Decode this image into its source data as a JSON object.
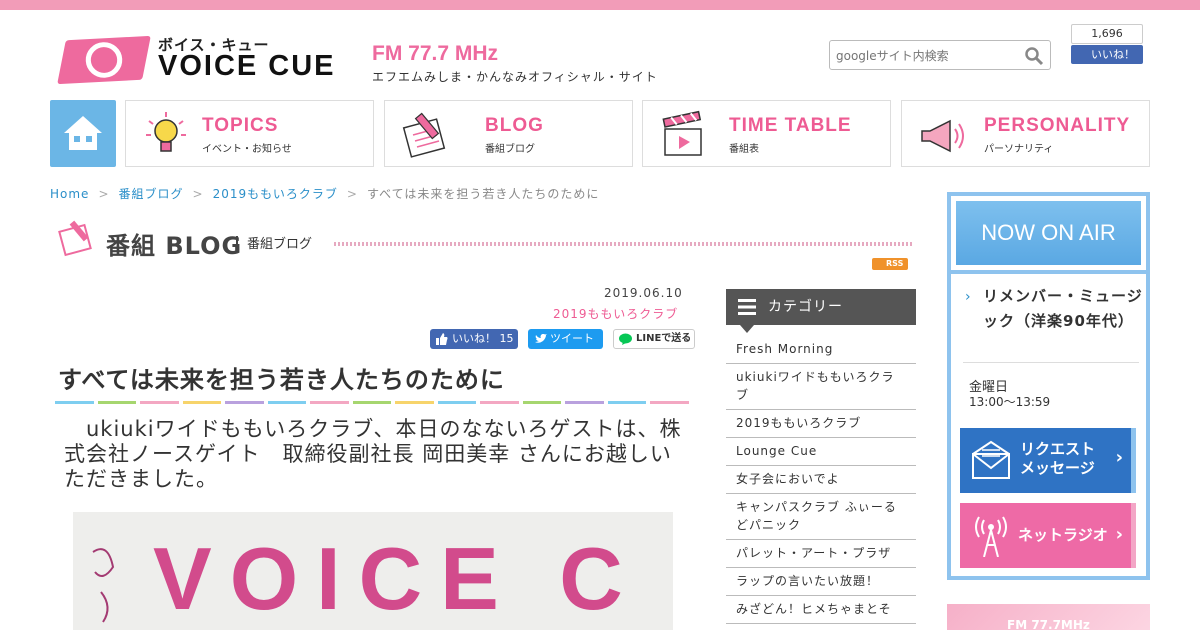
{
  "header": {
    "logo_kana": "ボイス・キュー",
    "logo_text": "VOICE CUE",
    "fm_label": "FM 77.7 MHz",
    "fm_sub": "エフエムみしま・かんなみオフィシャル・サイト",
    "search_placeholder": "googleサイト内検索",
    "fb_count": "1,696",
    "fb_like": "いいね！"
  },
  "nav": [
    {
      "title": "TOPICS",
      "sub": "イベント・お知らせ"
    },
    {
      "title": "BLOG",
      "sub": "番組ブログ"
    },
    {
      "title": "TIME TABLE",
      "sub": "番組表"
    },
    {
      "title": "PERSONALITY",
      "sub": "パーソナリティ"
    }
  ],
  "breadcrumb": {
    "home": "Home",
    "l1": "番組ブログ",
    "l2": "2019ももいろクラブ",
    "current": "すべては未来を担う若き人たちのために",
    "sep": ">"
  },
  "blog_heading": {
    "title": "番組 BLOG",
    "sub": "番組ブログ",
    "rss": "RSS"
  },
  "article": {
    "date": "2019.06.10",
    "category": "2019ももいろクラブ",
    "share_fb": "いいね！ 15",
    "share_tw": "ツイート",
    "share_line": "LINEで送る",
    "title": "すべては未来を担う若き人たちのために",
    "body": "　ukiukiワイドももいろクラブ、本日のなないろゲストは、株式会社ノースゲイト　取締役副社長 岡田美幸 さんにお越しいただきました。",
    "photo_text": "VOICE C"
  },
  "rainbow_colors": [
    "#7ecef0",
    "#a6d66f",
    "#f3a7c2",
    "#f7d46b",
    "#b9a1de",
    "#7ecef0",
    "#f3a7c2",
    "#a6d66f",
    "#f7d46b",
    "#7ecef0",
    "#f3a7c2",
    "#a6d66f",
    "#b9a1de",
    "#7ecef0",
    "#f3a7c2"
  ],
  "sidebar": {
    "heading": "カテゴリー",
    "items": [
      "Fresh Morning",
      "ukiukiワイドももいろクラブ",
      "2019ももいろクラブ",
      "Lounge Cue",
      "女子会においでよ",
      "キャンパスクラブ ふぃーるどパニック",
      "パレット・アート・プラザ",
      "ラップの言いたい放題！",
      "みざどん！ヒメちゃまとそ"
    ]
  },
  "now_on_air": {
    "head": "NOW ON AIR",
    "program": "リメンバー・ミュージック（洋楽90年代）",
    "day": "金曜日",
    "time": "13:00～13:59",
    "request": "リクエスト\nメッセージ",
    "net_radio": "ネットラジオ",
    "banner": "FM 77.7MHz"
  },
  "colors": {
    "accent_pink": "#ee5b93",
    "link_blue": "#2b8fc9",
    "air_blue": "#8ec3ee"
  }
}
